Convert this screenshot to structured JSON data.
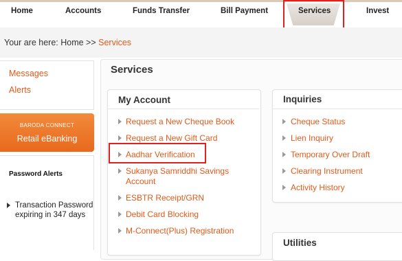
{
  "nav": {
    "items": [
      "Home",
      "Accounts",
      "Funds Transfer",
      "Bill Payment",
      "Services",
      "Invest"
    ]
  },
  "breadcrumb": {
    "prefix": "Your are here: Home >> ",
    "current": "Services"
  },
  "sidebar": {
    "links": [
      "Messages",
      "Alerts"
    ],
    "brand_top": "BARODA CONNECT",
    "brand_bottom": "Retail eBanking",
    "password_alerts_title": "Password Alerts",
    "password_alert_text": "Transaction Password expiring in 347 days"
  },
  "main": {
    "title": "Services",
    "my_account": {
      "title": "My Account",
      "items": [
        "Request a New Cheque Book",
        "Request a New Gift Card",
        "Aadhar Verification",
        "Sukanya Samriddhi Savings Account",
        "ESBTR Receipt/GRN",
        "Debit Card Blocking",
        "M-Connect(Plus) Registration"
      ]
    },
    "inquiries": {
      "title": "Inquiries",
      "items": [
        "Cheque Status",
        "Lien Inquiry",
        "Temporary Over Draft",
        "Clearing Instrument",
        "Activity History"
      ]
    },
    "utilities": {
      "title": "Utilities"
    }
  },
  "colors": {
    "link": "#e05a1a",
    "highlight": "#e02020",
    "brand": "#ef7a2c"
  }
}
